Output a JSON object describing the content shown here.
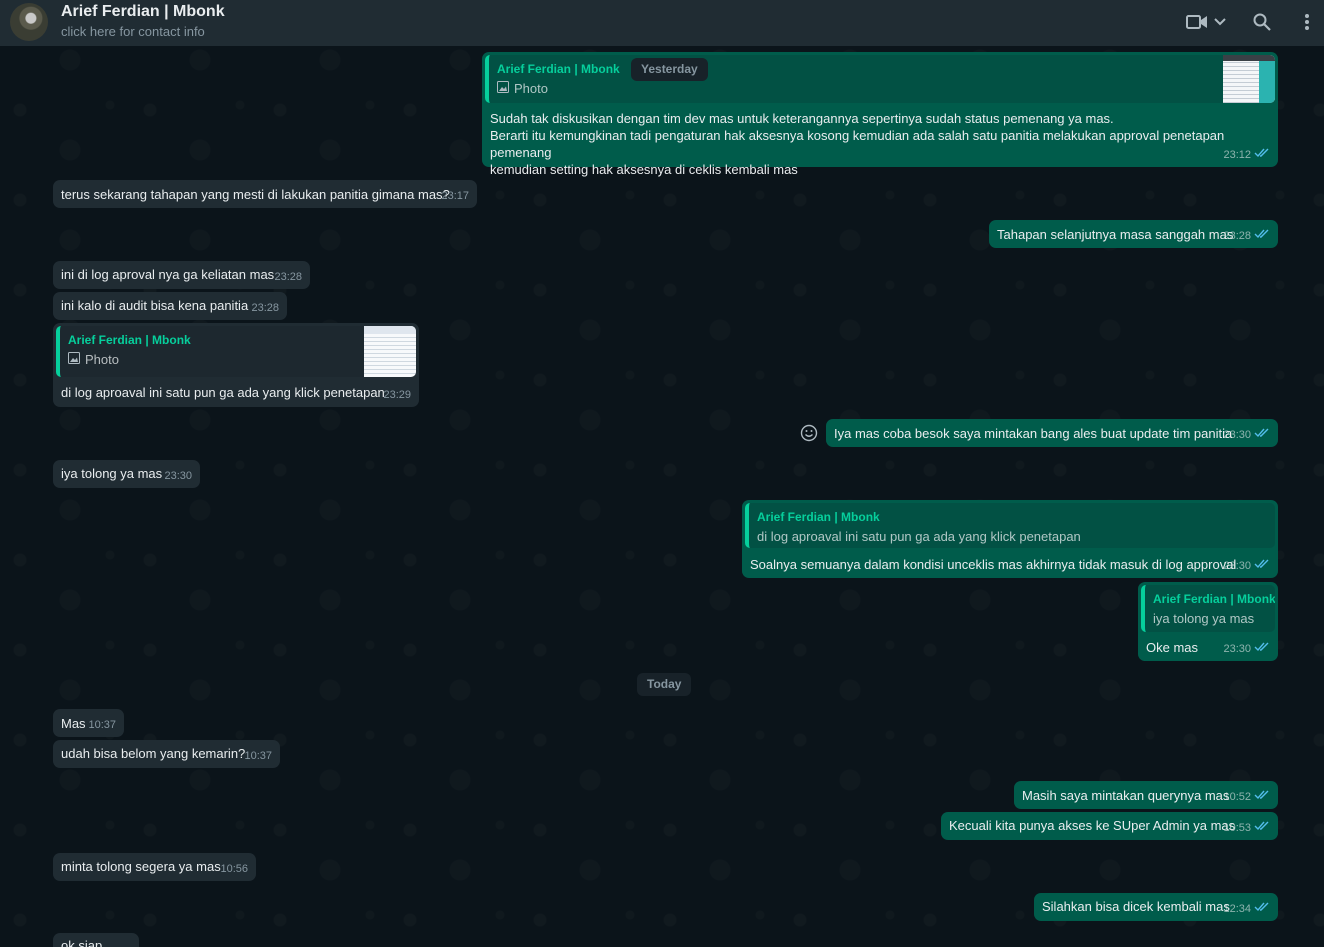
{
  "header": {
    "contact_name": "Arief Ferdian | Mbonk",
    "contact_sub": "click here for contact info"
  },
  "colors": {
    "background": "#0b141a",
    "header": "#202c33",
    "incoming_bubble": "#202c33",
    "outgoing_bubble": "#005c4b",
    "accent": "#06cf9c",
    "read_ticks": "#53bdeb"
  },
  "icons": [
    "video-call-icon",
    "chevron-down-icon",
    "search-icon",
    "menu-icon",
    "photo-icon",
    "emoji-icon",
    "double-check-icon"
  ],
  "messages": {
    "m1": {
      "quote_author": "Arief Ferdian | Mbonk",
      "quote_text": "Photo",
      "text": "Sudah tak diskusikan dengan tim dev mas untuk keterangannya sepertinya sudah status pemenang ya mas.\nBerarti itu kemungkinan tadi pengaturan hak aksesnya kosong kemudian ada salah satu panitia melakukan approval penetapan pemenang\nkemudian setting hak aksesnya di ceklis kembali mas",
      "time": "23:12"
    },
    "yesterday_label": "Yesterday",
    "m2": {
      "text": "terus sekarang tahapan yang mesti di lakukan panitia gimana mas?",
      "time": "23:17"
    },
    "m3": {
      "text": "Tahapan selanjutnya masa sanggah mas",
      "time": "23:28"
    },
    "m4": {
      "text": "ini di log aproval nya ga keliatan mas",
      "time": "23:28"
    },
    "m5": {
      "text": "ini kalo di audit bisa kena panitia",
      "time": "23:28"
    },
    "m6": {
      "quote_author": "Arief Ferdian | Mbonk",
      "quote_text": "Photo",
      "text": "di log aproaval ini satu pun ga ada yang klick penetapan",
      "time": "23:29"
    },
    "m7": {
      "text": "Iya mas coba besok saya mintakan bang ales buat update tim panitia",
      "time": "23:30"
    },
    "m8": {
      "text": "iya tolong ya mas",
      "time": "23:30"
    },
    "m9": {
      "quote_author": "Arief Ferdian | Mbonk",
      "quote_text": "di log aproaval ini satu pun ga ada yang klick penetapan",
      "text": "Soalnya semuanya dalam kondisi unceklis mas akhirnya tidak masuk di log approval",
      "time": "23:30"
    },
    "m10": {
      "quote_author": "Arief Ferdian | Mbonk",
      "quote_text": "iya tolong ya mas",
      "text": "Oke mas",
      "time": "23:30"
    },
    "today_label": "Today",
    "m11": {
      "text": "Mas",
      "time": "10:37"
    },
    "m12": {
      "text": "udah bisa belom yang kemarin?",
      "time": "10:37"
    },
    "m13": {
      "text": "Masih saya mintakan querynya mas",
      "time": "10:52"
    },
    "m14": {
      "text": "Kecuali kita punya akses ke SUper Admin ya mas",
      "time": "10:53"
    },
    "m15": {
      "text": "minta tolong segera ya mas",
      "time": "10:56"
    },
    "m16": {
      "text": "Silahkan bisa dicek kembali mas",
      "time": "12:34"
    },
    "m17": {
      "text": "ok siap"
    }
  }
}
